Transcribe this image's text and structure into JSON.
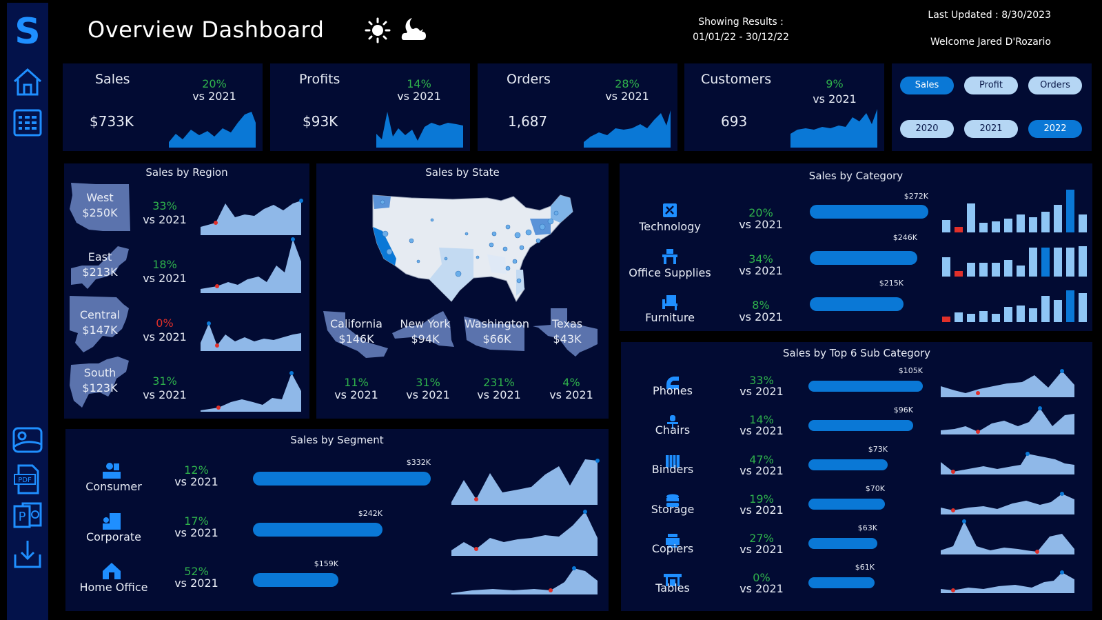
{
  "header": {
    "title": "Overview Dashboard",
    "showing_label": "Showing Results :",
    "date_range": "01/01/22 - 30/12/22",
    "last_updated": "Last Updated : 8/30/2023",
    "welcome": "Welcome Jared D'Rozario",
    "icons": [
      "sun-icon",
      "moon-cloud-icon"
    ]
  },
  "sidebar": {
    "logo": "S",
    "icons": [
      "home-icon",
      "list-icon",
      "image-export-icon",
      "pdf-icon",
      "powerpoint-icon",
      "download-icon"
    ]
  },
  "kpis": [
    {
      "label": "Sales",
      "value": "$733K",
      "pct": "20%",
      "vs": "vs 2021"
    },
    {
      "label": "Profits",
      "value": "$93K",
      "pct": "14%",
      "vs": "vs 2021"
    },
    {
      "label": "Orders",
      "value": "1,687",
      "pct": "28%",
      "vs": "vs 2021"
    },
    {
      "label": "Customers",
      "value": "693",
      "pct": "9%",
      "vs": "vs 2021"
    }
  ],
  "filters": {
    "metrics": [
      {
        "label": "Sales",
        "active": true
      },
      {
        "label": "Profit",
        "active": false
      },
      {
        "label": "Orders",
        "active": false
      }
    ],
    "years": [
      {
        "label": "2020",
        "active": false
      },
      {
        "label": "2021",
        "active": false
      },
      {
        "label": "2022",
        "active": true
      }
    ]
  },
  "region": {
    "title": "Sales by Region",
    "items": [
      {
        "name": "West",
        "value": "$250K",
        "pct": "33%",
        "vs": "vs 2021",
        "trend": "up"
      },
      {
        "name": "East",
        "value": "$213K",
        "pct": "18%",
        "vs": "vs 2021",
        "trend": "up"
      },
      {
        "name": "Central",
        "value": "$147K",
        "pct": "0%",
        "vs": "vs 2021",
        "trend": "down"
      },
      {
        "name": "South",
        "value": "$123K",
        "pct": "31%",
        "vs": "vs 2021",
        "trend": "up"
      }
    ]
  },
  "state": {
    "title": "Sales by State",
    "items": [
      {
        "name": "California",
        "value": "$146K",
        "pct": "11%",
        "vs": "vs 2021"
      },
      {
        "name": "New York",
        "value": "$94K",
        "pct": "31%",
        "vs": "vs 2021"
      },
      {
        "name": "Washington",
        "value": "$66K",
        "pct": "231%",
        "vs": "vs 2021"
      },
      {
        "name": "Texas",
        "value": "$43K",
        "pct": "4%",
        "vs": "vs 2021"
      }
    ]
  },
  "category": {
    "title": "Sales by Category",
    "items": [
      {
        "name": "Technology",
        "icon": "technology-icon",
        "pct": "20%",
        "vs": "vs 2021",
        "value_label": "$272K",
        "value": 272
      },
      {
        "name": "Office Supplies",
        "icon": "office-supplies-icon",
        "pct": "34%",
        "vs": "vs 2021",
        "value_label": "$246K",
        "value": 246
      },
      {
        "name": "Furniture",
        "icon": "furniture-icon",
        "pct": "8%",
        "vs": "vs 2021",
        "value_label": "$215K",
        "value": 215
      }
    ]
  },
  "subcategory": {
    "title": "Sales by Top 6 Sub Category",
    "items": [
      {
        "name": "Phones",
        "icon": "phone-icon",
        "pct": "33%",
        "vs": "vs 2021",
        "value_label": "$105K",
        "value": 105
      },
      {
        "name": "Chairs",
        "icon": "chair-icon",
        "pct": "14%",
        "vs": "vs 2021",
        "value_label": "$96K",
        "value": 96
      },
      {
        "name": "Binders",
        "icon": "binder-icon",
        "pct": "47%",
        "vs": "vs 2021",
        "value_label": "$73K",
        "value": 73
      },
      {
        "name": "Storage",
        "icon": "storage-icon",
        "pct": "19%",
        "vs": "vs 2021",
        "value_label": "$70K",
        "value": 70
      },
      {
        "name": "Copiers",
        "icon": "copier-icon",
        "pct": "27%",
        "vs": "vs 2021",
        "value_label": "$63K",
        "value": 63
      },
      {
        "name": "Tables",
        "icon": "table-icon",
        "pct": "0%",
        "vs": "vs 2021",
        "value_label": "$61K",
        "value": 61
      }
    ]
  },
  "segment": {
    "title": "Sales by Segment",
    "items": [
      {
        "name": "Consumer",
        "icon": "consumer-icon",
        "pct": "12%",
        "vs": "vs 2021",
        "value_label": "$332K",
        "value": 332
      },
      {
        "name": "Corporate",
        "icon": "corporate-icon",
        "pct": "17%",
        "vs": "vs 2021",
        "value_label": "$242K",
        "value": 242
      },
      {
        "name": "Home Office",
        "icon": "home-office-icon",
        "pct": "52%",
        "vs": "vs 2021",
        "value_label": "$159K",
        "value": 159
      }
    ]
  },
  "colors": {
    "background": "#000000",
    "panel": "#020b33",
    "accent": "#0a78d6",
    "light_fill": "#8fb8e8",
    "positive": "#2fb24c",
    "negative": "#e0302a"
  }
}
